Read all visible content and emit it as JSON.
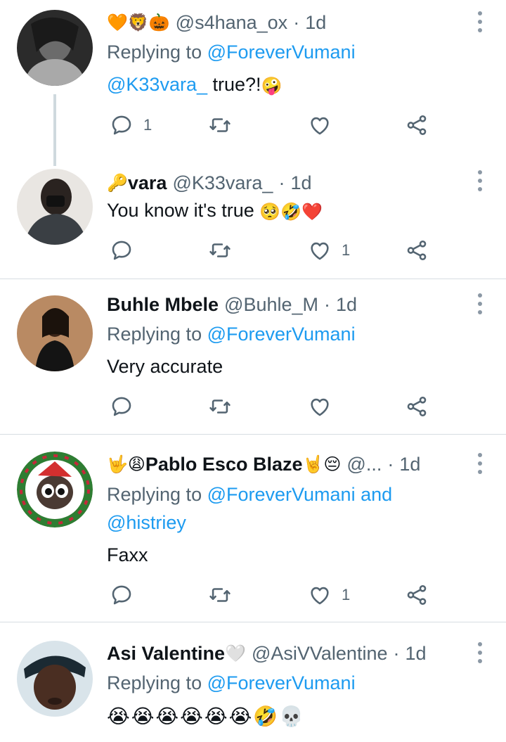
{
  "tweets": [
    {
      "name": "",
      "name_emojis": "🧡🦁🎃",
      "handle": "@s4hana_ox",
      "time": "1d",
      "replying_prefix": "Replying to ",
      "replying_to": "@ForeverVumani",
      "mention": "@K33vara_",
      "text": " true?!",
      "text_emojis": "🤪",
      "reply_count": "1",
      "like_count": "",
      "avatar_color": "#2b2b2b"
    },
    {
      "name_emojis": "🔑",
      "name": "vara",
      "handle": "@K33vara_",
      "time": "1d",
      "text": "You know it's true ",
      "text_emojis": "🥺🤣❤️",
      "reply_count": "",
      "like_count": "1",
      "avatar_color": "#3a3f44"
    },
    {
      "name": "Buhle Mbele",
      "handle": "@Buhle_M",
      "time": "1d",
      "replying_prefix": "Replying to ",
      "replying_to": "@ForeverVumani",
      "text": "Very accurate",
      "reply_count": "",
      "like_count": "",
      "avatar_color": "#b98a63"
    },
    {
      "name_emojis": "🤟😩",
      "name": "Pablo Esco Blaze",
      "name_emojis_after": "🤘😔",
      "handle": "@...",
      "time": "1d",
      "replying_prefix": "Replying to ",
      "replying_to": "@ForeverVumani",
      "replying_and": " and",
      "replying_to_2": "@histriey",
      "text": "Faxx",
      "reply_count": "",
      "like_count": "1",
      "avatar_color": "#c6283a"
    },
    {
      "name": "Asi Valentine",
      "name_emojis": "🤍",
      "handle": "@AsiVValentine",
      "time": "1d",
      "replying_prefix": "Replying to ",
      "replying_to": "@ForeverVumani",
      "text_emojis": "😭😭😭😭😭😭🤣💀",
      "avatar_color": "#4a2e22"
    }
  ],
  "separator": "·",
  "icons": [
    "reply-icon",
    "retweet-icon",
    "like-icon",
    "share-icon",
    "more-options-icon"
  ],
  "colors": {
    "link": "#1d9bf0",
    "secondary": "#536471",
    "separator": "#d7dde2"
  }
}
